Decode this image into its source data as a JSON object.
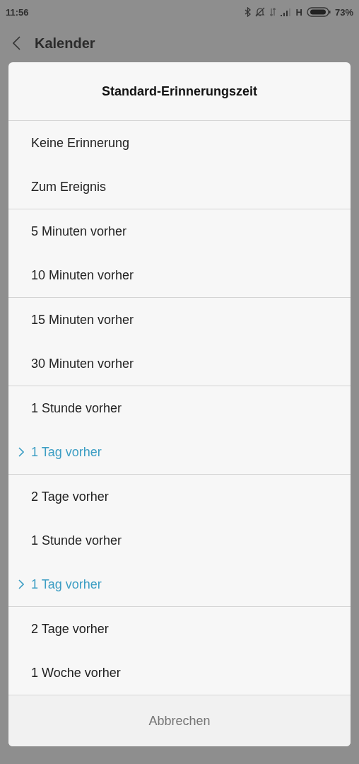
{
  "status_bar": {
    "time": "11:56",
    "network": "H",
    "battery": "73%"
  },
  "header": {
    "title": "Kalender"
  },
  "dialog": {
    "title": "Standard-Erinnerungszeit",
    "groups": [
      {
        "items": [
          {
            "label": "Keine Erinnerung",
            "selected": false
          },
          {
            "label": "Zum Ereignis",
            "selected": false
          }
        ]
      },
      {
        "items": [
          {
            "label": "5 Minuten vorher",
            "selected": false
          },
          {
            "label": "10 Minuten vorher",
            "selected": false
          }
        ]
      },
      {
        "items": [
          {
            "label": "15 Minuten vorher",
            "selected": false
          },
          {
            "label": "30 Minuten vorher",
            "selected": false
          }
        ]
      },
      {
        "items": [
          {
            "label": "1 Stunde vorher",
            "selected": false
          },
          {
            "label": "1 Tag vorher",
            "selected": true
          }
        ]
      },
      {
        "items": [
          {
            "label": "2 Tage vorher",
            "selected": false
          },
          {
            "label": "1 Stunde vorher",
            "selected": false
          },
          {
            "label": "1 Tag vorher",
            "selected": true
          }
        ]
      },
      {
        "items": [
          {
            "label": "2 Tage vorher",
            "selected": false
          },
          {
            "label": "1 Woche vorher",
            "selected": false
          }
        ]
      }
    ],
    "cancel": "Abbrechen"
  }
}
